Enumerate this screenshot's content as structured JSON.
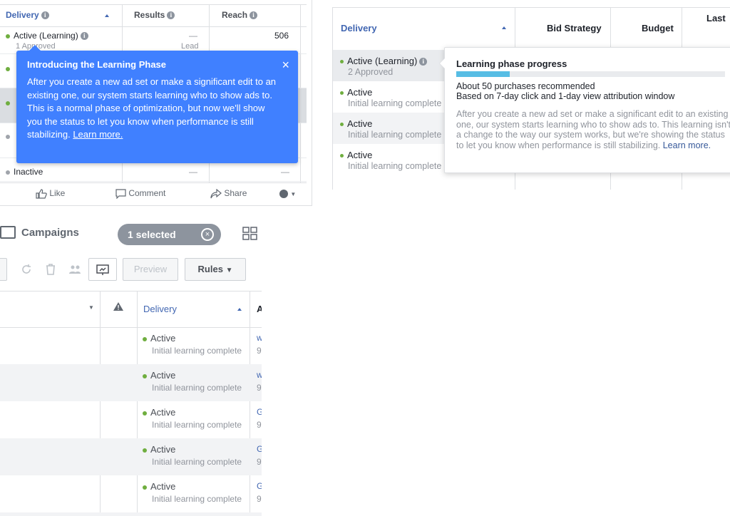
{
  "panel_a": {
    "headers": {
      "delivery": "Delivery",
      "results": "Results",
      "reach": "Reach"
    },
    "row1": {
      "status": "Active (Learning)",
      "sub": "1 Approved",
      "results": "—",
      "results_sub": "Lead",
      "reach": "506"
    },
    "last_row": {
      "status": "Inactive",
      "results": "—",
      "reach": "—"
    },
    "tooltip": {
      "title": "Introducing the Learning Phase",
      "body": "After you create a new ad set or make a significant edit to an existing one, our system starts learning who to show ads to. This is a normal phase of optimization, but now we'll show you the status to let you know when performance is still stabilizing. ",
      "link": "Learn more.",
      "close": "×"
    },
    "footer": {
      "like": "Like",
      "comment": "Comment",
      "share": "Share"
    }
  },
  "panel_b": {
    "headers": {
      "delivery": "Delivery",
      "bid_strategy": "Bid Strategy",
      "budget": "Budget",
      "last": "Last S"
    },
    "rows": [
      {
        "status": "Active (Learning)",
        "sub": "2 Approved"
      },
      {
        "status": "Active",
        "sub": "Initial learning complete"
      },
      {
        "status": "Active",
        "sub": "Initial learning complete"
      },
      {
        "status": "Active",
        "sub": "Initial learning complete"
      }
    ],
    "tooltip": {
      "title": "Learning phase progress",
      "progress": 0.2,
      "line1": "About 50 purchases recommended",
      "line2": "Based on 7-day click and 1-day view attribution window",
      "desc": "After you create a new ad set or make a significant edit to an existing one, our system starts learning who to show ads to. This learning isn't a change to the way our system works, but we're showing the status to let you know when performance is still stabilizing. ",
      "link": "Learn more."
    }
  },
  "panel_c": {
    "title": "Campaigns",
    "selected": "1 selected",
    "toolbar": {
      "preview": "Preview",
      "rules": "Rules"
    },
    "headers": {
      "delivery": "Delivery",
      "next": "A"
    },
    "rows": [
      {
        "status": "Active",
        "sub": "Initial learning complete",
        "edge1": "w",
        "edge2": "9"
      },
      {
        "status": "Active",
        "sub": "Initial learning complete",
        "edge1": "w",
        "edge2": "9"
      },
      {
        "status": "Active",
        "sub": "Initial learning complete",
        "edge1": "G",
        "edge2": "9"
      },
      {
        "status": "Active",
        "sub": "Initial learning complete",
        "edge1": "G",
        "edge2": "9"
      },
      {
        "status": "Active",
        "sub": "Initial learning complete",
        "edge1": "G",
        "edge2": "9"
      }
    ]
  },
  "colors": {
    "facebook_blue": "#4080ff",
    "link_blue": "#4267b2",
    "active_green": "#6fae3f",
    "progress_fill": "#57bde4"
  }
}
